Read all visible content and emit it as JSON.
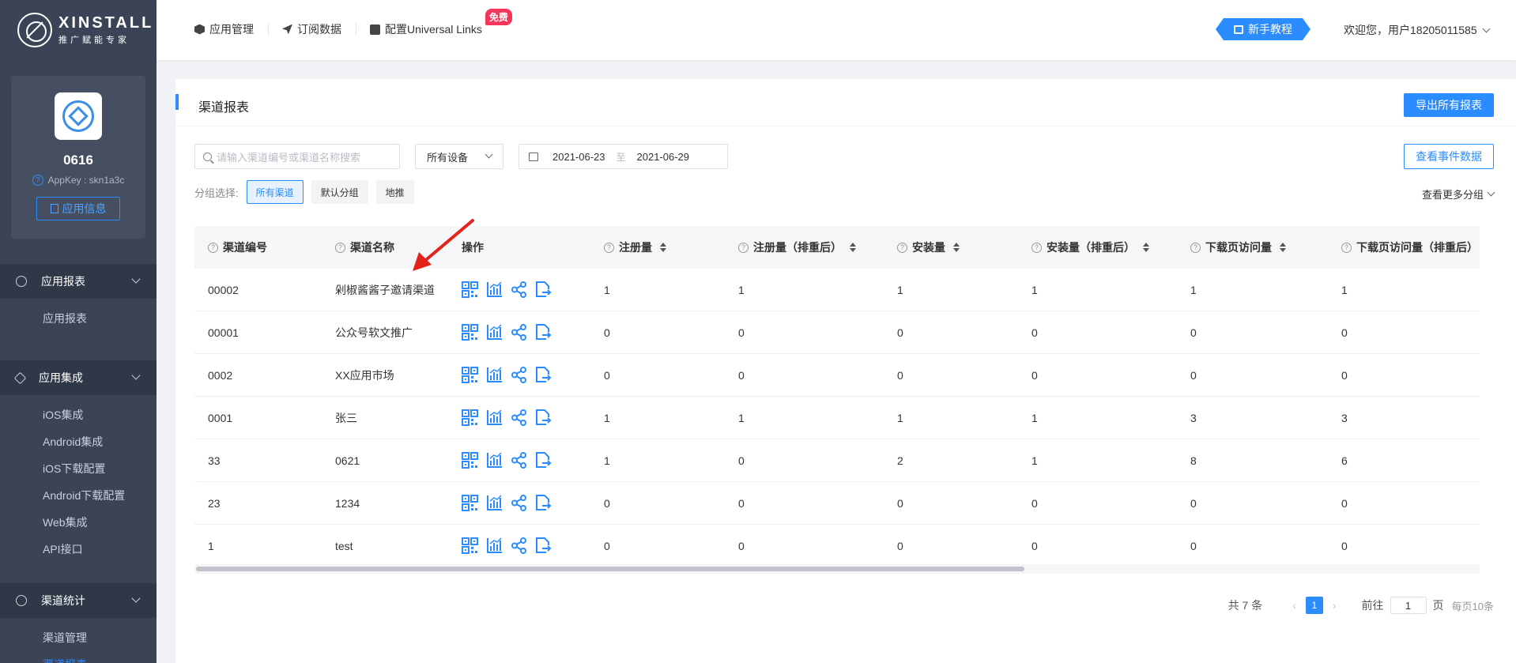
{
  "brand": {
    "name": "XINSTALL",
    "tagline": "推广赋能专家"
  },
  "app": {
    "name": "0616",
    "appkey": "AppKey : skn1a3c",
    "info_button": "应用信息"
  },
  "sidebar": {
    "groups": [
      {
        "title": "应用报表",
        "items": [
          {
            "label": "应用报表"
          }
        ]
      },
      {
        "title": "应用集成",
        "items": [
          {
            "label": "iOS集成"
          },
          {
            "label": "Android集成"
          },
          {
            "label": "iOS下载配置"
          },
          {
            "label": "Android下载配置"
          },
          {
            "label": "Web集成"
          },
          {
            "label": "API接口"
          }
        ]
      },
      {
        "title": "渠道统计",
        "items": [
          {
            "label": "渠道管理"
          },
          {
            "label": "渠道报表"
          }
        ]
      }
    ]
  },
  "header": {
    "nav": [
      {
        "label": "应用管理"
      },
      {
        "label": "订阅数据"
      },
      {
        "label": "配置Universal Links"
      }
    ],
    "badge": "免费",
    "tutorial": "新手教程",
    "welcome": "欢迎您，用户18205011585"
  },
  "page": {
    "title": "渠道报表",
    "export_button": "导出所有报表",
    "search_placeholder": "请输入渠道编号或渠道名称搜索",
    "device_select": "所有设备",
    "date_start": "2021-06-23",
    "date_sep": "至",
    "date_end": "2021-06-29",
    "events_button": "查看事件数据",
    "group_label": "分组选择:",
    "groups": [
      {
        "label": "所有渠道"
      },
      {
        "label": "默认分组"
      },
      {
        "label": "地推"
      }
    ],
    "more_groups": "查看更多分组"
  },
  "table": {
    "headers": [
      "渠道编号",
      "渠道名称",
      "操作",
      "注册量",
      "注册量（排重后）",
      "安装量",
      "安装量（排重后）",
      "下载页访问量",
      "下载页访问量（排重后）"
    ],
    "rows": [
      [
        "00002",
        "剁椒酱酱子邀请渠道",
        "1",
        "1",
        "1",
        "1",
        "1",
        "1"
      ],
      [
        "00001",
        "公众号软文推广",
        "0",
        "0",
        "0",
        "0",
        "0",
        "0"
      ],
      [
        "0002",
        "XX应用市场",
        "0",
        "0",
        "0",
        "0",
        "0",
        "0"
      ],
      [
        "0001",
        "张三",
        "1",
        "1",
        "1",
        "1",
        "3",
        "3"
      ],
      [
        "33",
        "0621",
        "1",
        "0",
        "2",
        "1",
        "8",
        "6"
      ],
      [
        "23",
        "1234",
        "0",
        "0",
        "0",
        "0",
        "0",
        "0"
      ],
      [
        "1",
        "test",
        "0",
        "0",
        "0",
        "0",
        "0",
        "0"
      ]
    ]
  },
  "pagination": {
    "total": "共 7 条",
    "current": "1",
    "goto_label": "前往",
    "goto_value": "1",
    "page_unit": "页",
    "per_page": "每页10条"
  },
  "colors": {
    "accent": "#2b8cff",
    "sidebar": "#3a4456",
    "badge": "#f5365c",
    "arrow": "#e5211c"
  }
}
